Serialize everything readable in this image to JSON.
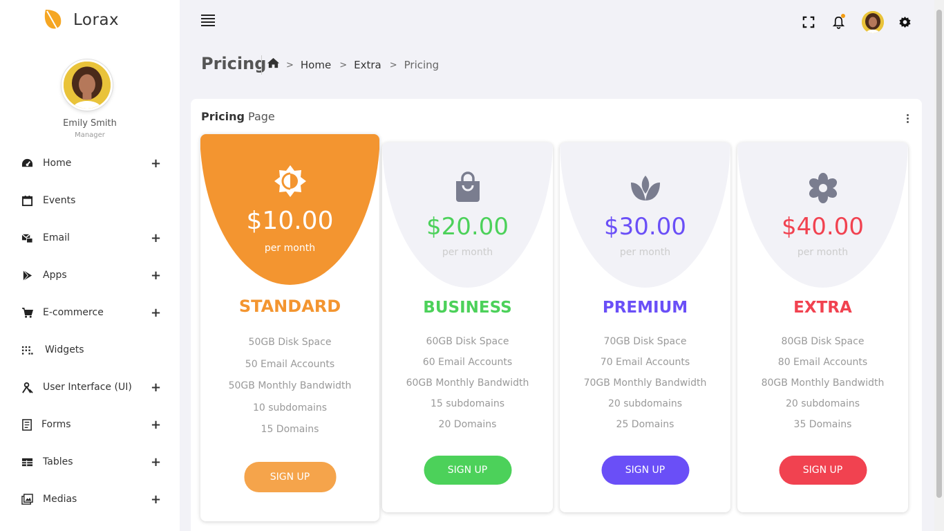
{
  "brand": {
    "name": "Lorax",
    "color": "#f39c12"
  },
  "profile": {
    "name": "Emily Smith",
    "role": "Manager"
  },
  "nav": [
    {
      "label": "Home",
      "icon": "dashboard-icon",
      "expandable": true
    },
    {
      "label": "Events",
      "icon": "calendar-icon",
      "expandable": false
    },
    {
      "label": "Email",
      "icon": "email-icon",
      "expandable": true
    },
    {
      "label": "Apps",
      "icon": "play-icon",
      "expandable": true
    },
    {
      "label": "E-commerce",
      "icon": "cart-icon",
      "expandable": true
    },
    {
      "label": "Widgets",
      "icon": "grid-dots-icon",
      "expandable": false
    },
    {
      "label": "User Interface (UI)",
      "icon": "user-interface-icon",
      "expandable": true
    },
    {
      "label": "Forms",
      "icon": "form-icon",
      "expandable": true
    },
    {
      "label": "Tables",
      "icon": "table-icon",
      "expandable": true
    },
    {
      "label": "Medias",
      "icon": "media-icon",
      "expandable": true
    }
  ],
  "nav_plus": "+",
  "header": {
    "title": "Pricing",
    "breadcrumb": [
      "Home",
      "Extra",
      "Pricing"
    ],
    "separator": ">"
  },
  "card": {
    "title_bold": "Pricing",
    "title_rest": "Page"
  },
  "plans": [
    {
      "price": "$10.00",
      "period": "per month",
      "name": "STANDARD",
      "icon": "sun-icon",
      "features": [
        "50GB Disk Space",
        "50 Email Accounts",
        "50GB Monthly Bandwidth",
        "10 subdomains",
        "15 Domains"
      ],
      "button": "SIGN UP",
      "color": "#f39530",
      "highlighted": true
    },
    {
      "price": "$20.00",
      "period": "per month",
      "name": "BUSINESS",
      "icon": "shopping-bag-icon",
      "features": [
        "60GB Disk Space",
        "60 Email Accounts",
        "60GB Monthly Bandwidth",
        "15 subdomains",
        "20 Domains"
      ],
      "button": "SIGN UP",
      "color": "#4cd15a",
      "highlighted": false
    },
    {
      "price": "$30.00",
      "period": "per month",
      "name": "PREMIUM",
      "icon": "lotus-icon",
      "features": [
        "70GB Disk Space",
        "70 Email Accounts",
        "70GB Monthly Bandwidth",
        "20 subdomains",
        "25 Domains"
      ],
      "button": "SIGN UP",
      "color": "#6a4ff7",
      "highlighted": false
    },
    {
      "price": "$40.00",
      "period": "per month",
      "name": "EXTRA",
      "icon": "flower-icon",
      "features": [
        "80GB Disk Space",
        "80 Email Accounts",
        "80GB Monthly Bandwidth",
        "20 subdomains",
        "35 Domains"
      ],
      "button": "SIGN UP",
      "color": "#f14250",
      "highlighted": false
    }
  ]
}
